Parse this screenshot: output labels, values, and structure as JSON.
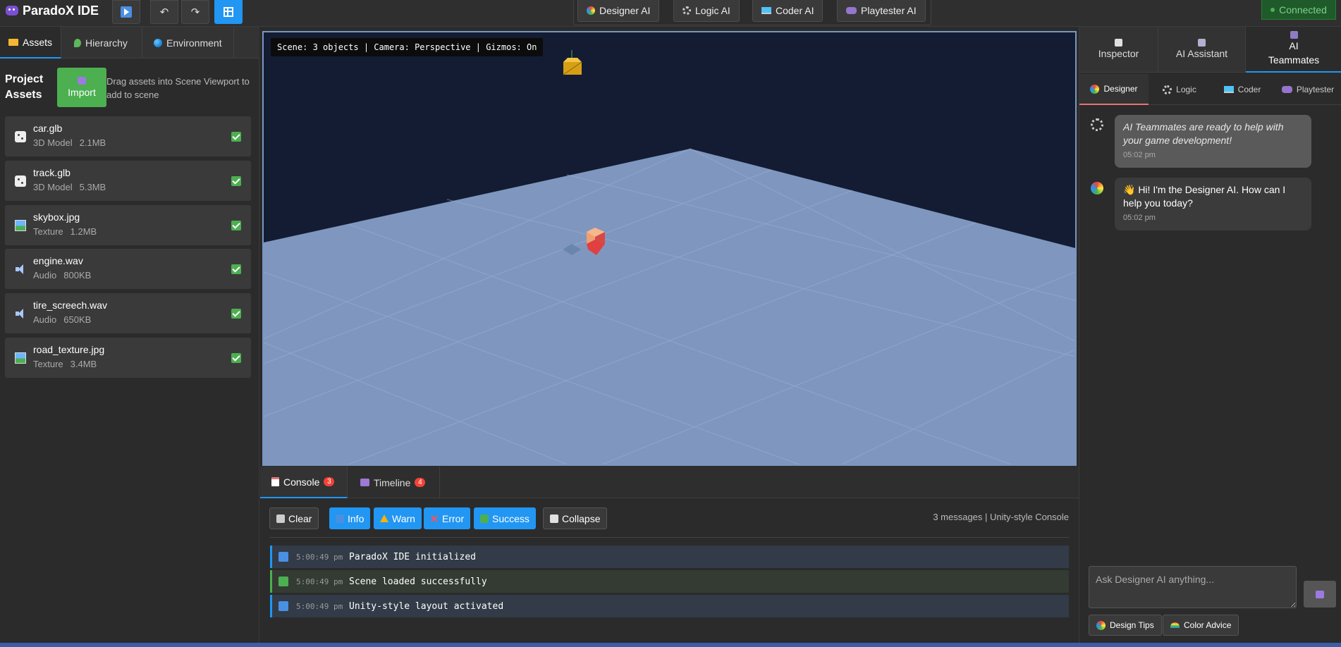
{
  "app": {
    "title": "ParadoX IDE"
  },
  "toolbar": {
    "undo_glyph": "↶",
    "redo_glyph": "↷"
  },
  "ai_buttons": [
    {
      "label": "Designer AI",
      "icon": "palette-icon"
    },
    {
      "label": "Logic AI",
      "icon": "gear-icon"
    },
    {
      "label": "Coder AI",
      "icon": "laptop-icon"
    },
    {
      "label": "Playtester AI",
      "icon": "gamepad-icon"
    }
  ],
  "status": {
    "connected": "Connected"
  },
  "left_panel": {
    "tabs": [
      {
        "label": "Assets",
        "icon": "folder-icon"
      },
      {
        "label": "Hierarchy",
        "icon": "leaf-icon"
      },
      {
        "label": "Environment",
        "icon": "globe-icon"
      }
    ],
    "project_assets_title": "Project Assets",
    "import_label": "Import",
    "drag_hint": "Drag assets into Scene Viewport to add to scene",
    "assets": [
      {
        "name": "car.glb",
        "type": "3D Model",
        "size": "2.1MB",
        "icon": "dice-icon"
      },
      {
        "name": "track.glb",
        "type": "3D Model",
        "size": "5.3MB",
        "icon": "dice-icon"
      },
      {
        "name": "skybox.jpg",
        "type": "Texture",
        "size": "1.2MB",
        "icon": "image-icon"
      },
      {
        "name": "engine.wav",
        "type": "Audio",
        "size": "800KB",
        "icon": "speaker-icon"
      },
      {
        "name": "tire_screech.wav",
        "type": "Audio",
        "size": "650KB",
        "icon": "speaker-icon"
      },
      {
        "name": "road_texture.jpg",
        "type": "Texture",
        "size": "3.4MB",
        "icon": "image-icon"
      }
    ]
  },
  "viewport": {
    "scene_info": "Scene: 3 objects | Camera: Perspective | Gizmos: On",
    "colors": {
      "sky": "#131c33",
      "floor": "#7f97bf",
      "grid": "#9db1d3"
    }
  },
  "console": {
    "tabs": [
      {
        "label": "Console",
        "count": "3"
      },
      {
        "label": "Timeline",
        "count": "4"
      }
    ],
    "buttons": {
      "clear": "Clear",
      "info": "Info",
      "warn": "Warn",
      "error": "Error",
      "success": "Success",
      "collapse": "Collapse"
    },
    "summary": "3 messages | Unity-style Console",
    "logs": [
      {
        "time": "5:00:49 pm",
        "message": "ParadoX IDE initialized",
        "level": "info"
      },
      {
        "time": "5:00:49 pm",
        "message": "Scene loaded successfully",
        "level": "success"
      },
      {
        "time": "5:00:49 pm",
        "message": "Unity-style layout activated",
        "level": "info"
      }
    ]
  },
  "right_panel": {
    "tabs": [
      {
        "label": "Inspector",
        "icon": "clipboard-icon"
      },
      {
        "label": "AI Assistant",
        "icon": "robot-icon"
      },
      {
        "label": "AI Teammates",
        "icon": "people-icon"
      }
    ],
    "subtabs": [
      {
        "label": "Designer",
        "icon": "palette-icon"
      },
      {
        "label": "Logic",
        "icon": "gear-icon"
      },
      {
        "label": "Coder",
        "icon": "laptop-icon"
      },
      {
        "label": "Playtester",
        "icon": "gamepad-icon"
      }
    ],
    "messages": [
      {
        "text": "AI Teammates are ready to help with your game development!",
        "time": "05:02 pm",
        "kind": "system"
      },
      {
        "text": "👋 Hi! I'm the Designer AI. How can I help you today?",
        "time": "05:02 pm",
        "kind": "ai"
      }
    ],
    "input_placeholder": "Ask Designer AI anything...",
    "chips": [
      {
        "label": "Design Tips",
        "icon": "palette-icon"
      },
      {
        "label": "Color Advice",
        "icon": "rainbow-icon"
      }
    ]
  }
}
